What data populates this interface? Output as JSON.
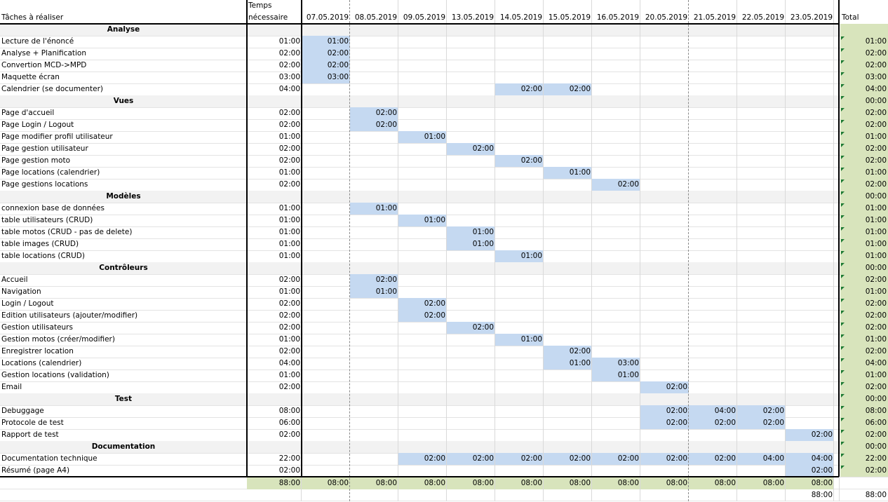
{
  "header": {
    "tasks_label": "Tâches à réaliser",
    "time_label_1": "Temps",
    "time_label_2": "nécessaire",
    "total_label": "Total",
    "dates": [
      "07.05.2019",
      "08.05.2019",
      "09.05.2019",
      "13.05.2019",
      "14.05.2019",
      "15.05.2019",
      "16.05.2019",
      "20.05.2019",
      "21.05.2019",
      "22.05.2019",
      "23.05.2019"
    ]
  },
  "rows": [
    {
      "type": "section",
      "label": "Analyse",
      "total": ""
    },
    {
      "type": "task",
      "label": "Lecture de l'énoncé",
      "time": "01:00",
      "cells": {
        "0": "01:00"
      },
      "total": "01:00"
    },
    {
      "type": "task",
      "label": "Analyse + Planification",
      "time": "02:00",
      "cells": {
        "0": "02:00"
      },
      "total": "02:00"
    },
    {
      "type": "task",
      "label": "Convertion MCD->MPD",
      "time": "02:00",
      "cells": {
        "0": "02:00"
      },
      "total": "02:00"
    },
    {
      "type": "task",
      "label": "Maquette écran",
      "time": "03:00",
      "cells": {
        "0": "03:00"
      },
      "total": "03:00"
    },
    {
      "type": "task",
      "label": "Calendrier (se documenter)",
      "time": "04:00",
      "cells": {
        "4": "02:00",
        "5": "02:00"
      },
      "total": "04:00"
    },
    {
      "type": "section",
      "label": "Vues",
      "total": "00:00"
    },
    {
      "type": "task",
      "label": "Page d'accueil",
      "time": "02:00",
      "cells": {
        "1": "02:00"
      },
      "total": "02:00"
    },
    {
      "type": "task",
      "label": "Page Login / Logout",
      "time": "02:00",
      "cells": {
        "1": "02:00"
      },
      "total": "02:00"
    },
    {
      "type": "task",
      "label": "Page modifier profil utilisateur",
      "time": "01:00",
      "cells": {
        "2": "01:00"
      },
      "total": "01:00"
    },
    {
      "type": "task",
      "label": "Page gestion utilisateur",
      "time": "02:00",
      "cells": {
        "3": "02:00"
      },
      "total": "02:00"
    },
    {
      "type": "task",
      "label": "Page gestion moto",
      "time": "02:00",
      "cells": {
        "4": "02:00"
      },
      "total": "02:00"
    },
    {
      "type": "task",
      "label": "Page locations (calendrier)",
      "time": "01:00",
      "cells": {
        "5": "01:00"
      },
      "total": "01:00"
    },
    {
      "type": "task",
      "label": "Page gestions locations",
      "time": "02:00",
      "cells": {
        "6": "02:00"
      },
      "total": "02:00"
    },
    {
      "type": "section",
      "label": "Modèles",
      "total": "00:00"
    },
    {
      "type": "task",
      "label": "connexion base de données",
      "time": "01:00",
      "cells": {
        "1": "01:00"
      },
      "total": "01:00"
    },
    {
      "type": "task",
      "label": "table utilisateurs (CRUD)",
      "time": "01:00",
      "cells": {
        "2": "01:00"
      },
      "total": "01:00"
    },
    {
      "type": "task",
      "label": "table motos (CRUD - pas de delete)",
      "time": "01:00",
      "cells": {
        "3": "01:00"
      },
      "total": "01:00"
    },
    {
      "type": "task",
      "label": "table images (CRUD)",
      "time": "01:00",
      "cells": {
        "3": "01:00"
      },
      "total": "01:00"
    },
    {
      "type": "task",
      "label": "table locations (CRUD)",
      "time": "01:00",
      "cells": {
        "4": "01:00"
      },
      "total": "01:00"
    },
    {
      "type": "section",
      "label": "Contrôleurs",
      "total": "00:00"
    },
    {
      "type": "task",
      "label": "Accueil",
      "time": "02:00",
      "cells": {
        "1": "02:00"
      },
      "total": "02:00"
    },
    {
      "type": "task",
      "label": "Navigation",
      "time": "01:00",
      "cells": {
        "1": "01:00"
      },
      "total": "01:00"
    },
    {
      "type": "task",
      "label": "Login / Logout",
      "time": "02:00",
      "cells": {
        "2": "02:00"
      },
      "total": "02:00"
    },
    {
      "type": "task",
      "label": "Edition utilisateurs (ajouter/modifier)",
      "time": "02:00",
      "cells": {
        "2": "02:00"
      },
      "total": "02:00"
    },
    {
      "type": "task",
      "label": "Gestion utilisateurs",
      "time": "02:00",
      "cells": {
        "3": "02:00"
      },
      "total": "02:00"
    },
    {
      "type": "task",
      "label": "Gestion motos (créer/modifier)",
      "time": "01:00",
      "cells": {
        "4": "01:00"
      },
      "total": "01:00"
    },
    {
      "type": "task",
      "label": "Enregistrer location",
      "time": "02:00",
      "cells": {
        "5": "02:00"
      },
      "total": "02:00"
    },
    {
      "type": "task",
      "label": "Locations (calendrier)",
      "time": "04:00",
      "cells": {
        "5": "01:00",
        "6": "03:00"
      },
      "total": "04:00"
    },
    {
      "type": "task",
      "label": "Gestion locations (validation)",
      "time": "01:00",
      "cells": {
        "6": "01:00"
      },
      "total": "01:00"
    },
    {
      "type": "task",
      "label": "Email",
      "time": "02:00",
      "cells": {
        "7": "02:00"
      },
      "total": "02:00"
    },
    {
      "type": "section",
      "label": "Test",
      "total": "00:00"
    },
    {
      "type": "task",
      "label": "Debuggage",
      "time": "08:00",
      "cells": {
        "7": "02:00",
        "8": "04:00",
        "9": "02:00"
      },
      "total": "08:00"
    },
    {
      "type": "task",
      "label": "Protocole de test",
      "time": "06:00",
      "cells": {
        "7": "02:00",
        "8": "02:00",
        "9": "02:00"
      },
      "total": "06:00"
    },
    {
      "type": "task",
      "label": "Rapport de test",
      "time": "02:00",
      "cells": {
        "10": "02:00"
      },
      "total": "02:00"
    },
    {
      "type": "section",
      "label": "Documentation",
      "total": "00:00"
    },
    {
      "type": "task",
      "label": "Documentation technique",
      "time": "22:00",
      "cells": {
        "2": "02:00",
        "3": "02:00",
        "4": "02:00",
        "5": "02:00",
        "6": "02:00",
        "7": "02:00",
        "8": "02:00",
        "9": "04:00",
        "10": "04:00"
      },
      "total": "22:00"
    },
    {
      "type": "task",
      "label": "Résumé (page A4)",
      "time": "02:00",
      "cells": {
        "10": "02:00"
      },
      "total": "02:00"
    }
  ],
  "footer": {
    "time_total": "88:00",
    "daily_totals": [
      "08:00",
      "08:00",
      "08:00",
      "08:00",
      "08:00",
      "08:00",
      "08:00",
      "08:00",
      "08:00",
      "08:00",
      "08:00"
    ],
    "last_row_value": "88:00",
    "grand_total": "88:00"
  },
  "colors": {
    "task_fill": "#c5d9f1",
    "total_fill": "#d8e4bc",
    "section_fill": "#f2f2f2",
    "comment_marker": "#1e7b34"
  }
}
